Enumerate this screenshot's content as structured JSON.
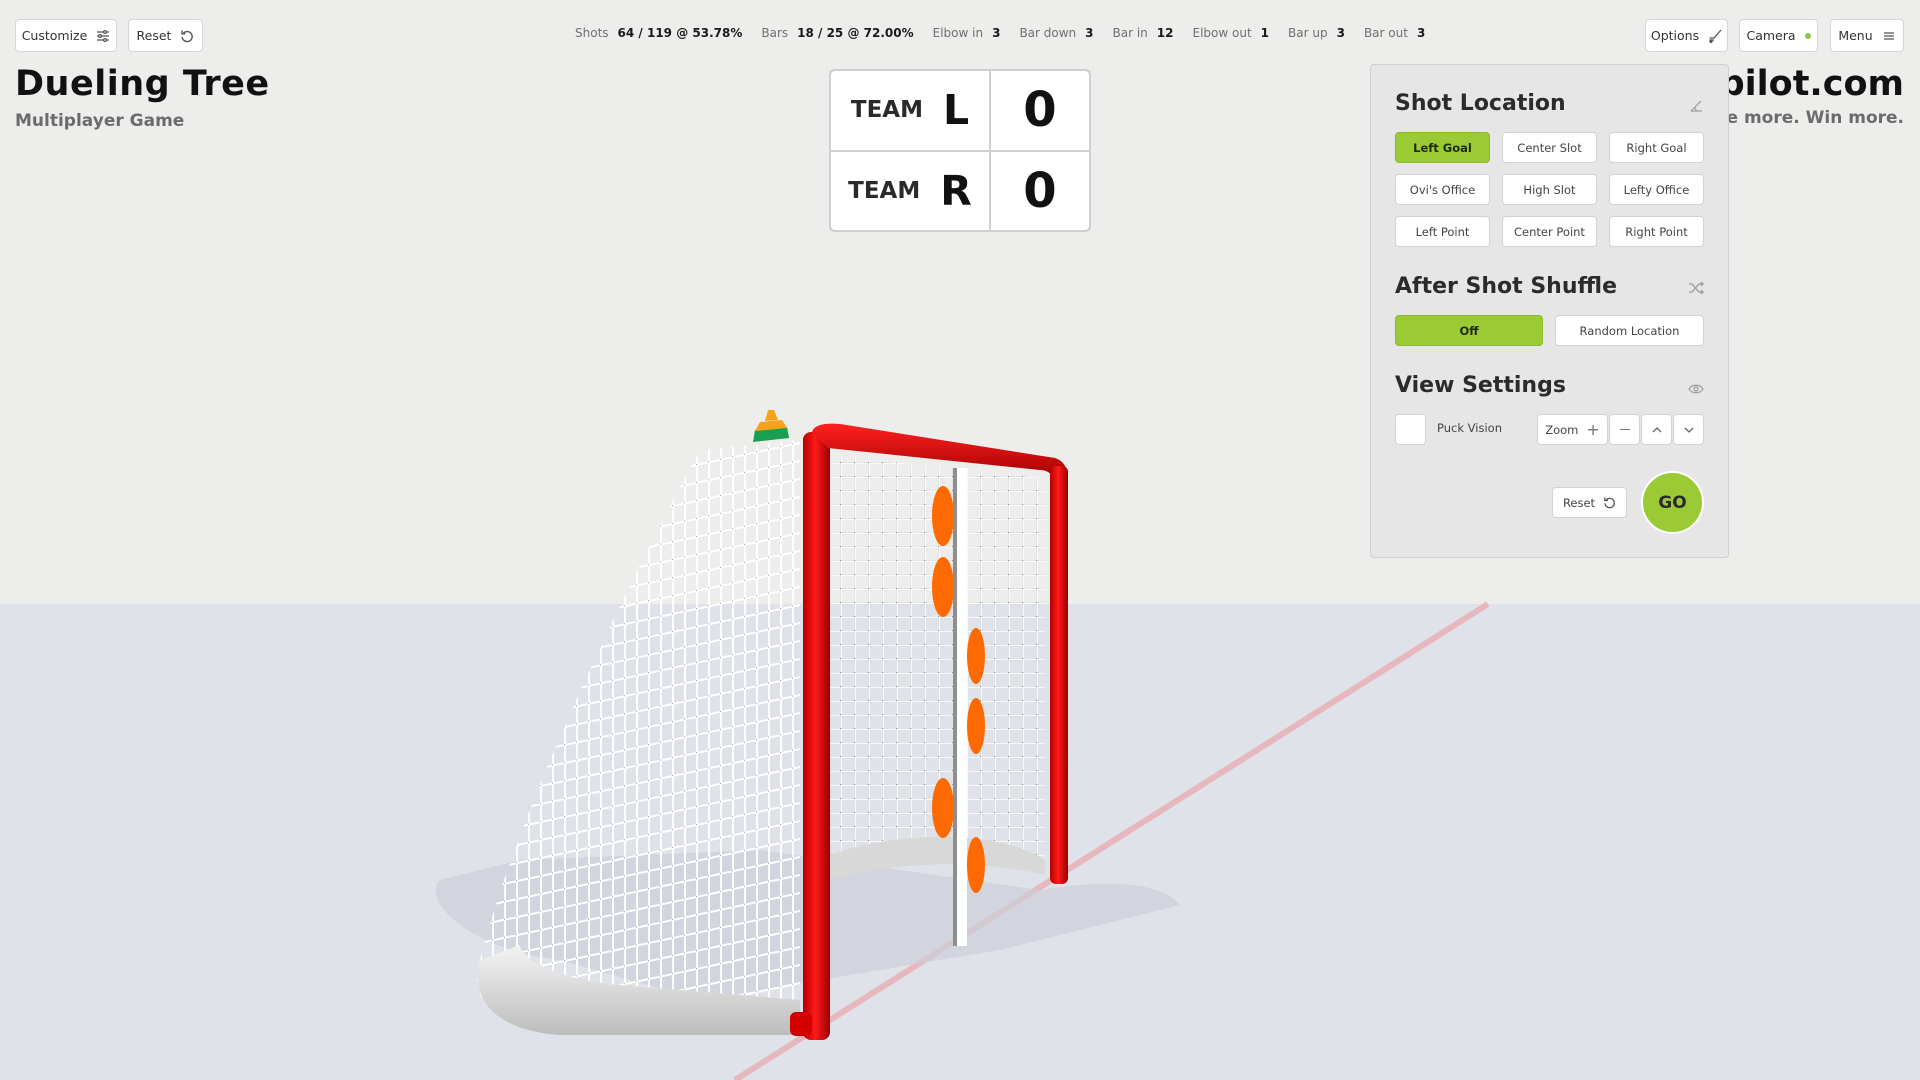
{
  "toolbar_left": {
    "customize_label": "Customize",
    "customize_icon": "sliders-icon",
    "reset_label": "Reset",
    "reset_icon": "rotate-ccw-icon"
  },
  "header": {
    "title": "Dueling Tree",
    "subtitle": "Multiplayer Game"
  },
  "brand": {
    "domain": "pilot.com",
    "tagline": "core more. Win more."
  },
  "stats": [
    {
      "label": "Shots",
      "value": "64 / 119 @ 53.78%"
    },
    {
      "label": "Bars",
      "value": "18 / 25 @ 72.00%"
    },
    {
      "label": "Elbow in",
      "value": "3"
    },
    {
      "label": "Bar down",
      "value": "3"
    },
    {
      "label": "Bar in",
      "value": "12"
    },
    {
      "label": "Elbow out",
      "value": "1"
    },
    {
      "label": "Bar up",
      "value": "3"
    },
    {
      "label": "Bar out",
      "value": "3"
    }
  ],
  "scoreboard": [
    {
      "team_word": "TEAM",
      "team_letter": "L",
      "score": "0"
    },
    {
      "team_word": "TEAM",
      "team_letter": "R",
      "score": "0"
    }
  ],
  "toolbar_right": {
    "options_label": "Options",
    "options_icon": "hockey-stick-icon",
    "camera_label": "Camera",
    "camera_status_color": "#8cc63f",
    "menu_label": "Menu",
    "menu_icon": "hamburger-icon"
  },
  "panel": {
    "shot_location": {
      "title": "Shot Location",
      "icon": "angle-icon",
      "selected": "Left Goal",
      "options": [
        "Left Goal",
        "Center Slot",
        "Right Goal",
        "Ovi's Office",
        "High Slot",
        "Lefty Office",
        "Left Point",
        "Center Point",
        "Right Point"
      ]
    },
    "after_shot_shuffle": {
      "title": "After Shot Shuffle",
      "icon": "shuffle-icon",
      "selected": "Off",
      "options": [
        "Off",
        "Random Location"
      ]
    },
    "view_settings": {
      "title": "View Settings",
      "icon": "eye-icon",
      "puck_vision_label": "Puck Vision",
      "puck_vision_checked": false,
      "zoom_label": "Zoom"
    },
    "reset_label": "Reset",
    "go_label": "GO"
  },
  "colors": {
    "accent": "#9acb34",
    "background": "#ededeb",
    "ice": "#e0e2e9",
    "goal_frame": "#e30d0d",
    "target": "#ff6a00",
    "red_line": "#e6b7bd"
  }
}
